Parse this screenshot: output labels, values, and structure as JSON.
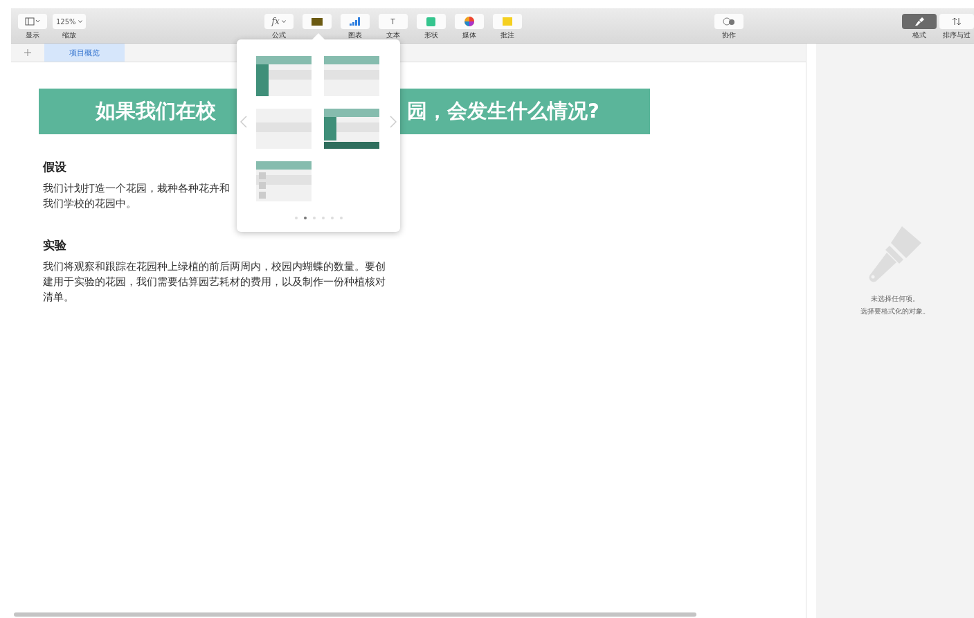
{
  "toolbar": {
    "left": [
      {
        "kind": "view",
        "label": "显示"
      },
      {
        "kind": "zoom",
        "text": "125%",
        "label": "缩放"
      }
    ],
    "center": [
      {
        "kind": "formula",
        "text": "fx",
        "label": "公式"
      },
      {
        "kind": "table"
      },
      {
        "kind": "chart",
        "label": "图表"
      },
      {
        "kind": "text",
        "text": "T",
        "label": "文本"
      },
      {
        "kind": "shape",
        "label": "形状"
      },
      {
        "kind": "media",
        "label": "媒体"
      },
      {
        "kind": "comment",
        "label": "批注"
      }
    ],
    "collab": {
      "label": "协作"
    },
    "right": [
      {
        "kind": "format",
        "label": "格式",
        "selected": true
      },
      {
        "kind": "sort",
        "label": "排序与过",
        "selected": false
      }
    ]
  },
  "sheet_tabs": [
    {
      "label": "项目概览",
      "selected": true
    }
  ],
  "title_banner": {
    "left_text": "如果我们在校",
    "right_text": "园，会发生什么情况?"
  },
  "sections": [
    {
      "heading": "假设",
      "lines": [
        "我们计划打造一个花园，栽种各种花卉和",
        "我们学校的花园中。"
      ]
    },
    {
      "heading": "实验",
      "lines": [
        "我们将观察和跟踪在花园种上绿植的前后两周内，校园内蝴蝶的数量。要创建用于实验的花园，我们需要估算园艺耗材的费用，以及制作一份种植核对清单。"
      ]
    }
  ],
  "table_styles_popover": {
    "styles": [
      {
        "kind": "header-row-column"
      },
      {
        "kind": "header-row"
      },
      {
        "kind": "plain"
      },
      {
        "kind": "header-row-column-footer"
      },
      {
        "kind": "header-row-checkbox"
      }
    ],
    "pages": [
      {
        "selected": false
      },
      {
        "selected": true
      },
      {
        "selected": false
      },
      {
        "selected": false
      },
      {
        "selected": false
      },
      {
        "selected": false
      }
    ]
  },
  "format_panel": {
    "lines": [
      "未选择任何项。",
      "选择要格式化的对象。"
    ]
  }
}
